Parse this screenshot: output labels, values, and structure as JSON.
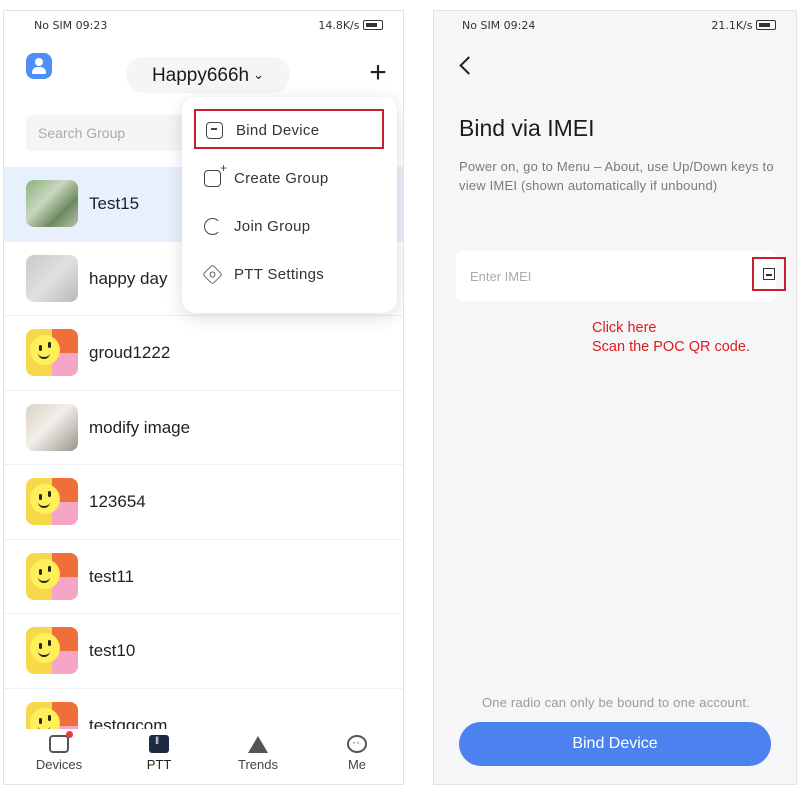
{
  "left_screen": {
    "status_bar": {
      "left": "No SIM 09:23",
      "right": "14.8K/s"
    },
    "header": {
      "account_name": "Happy666h",
      "chevron": "⌄",
      "plus": "+"
    },
    "search": {
      "placeholder": "Search Group"
    },
    "groups": [
      {
        "name": "Test15",
        "avatar": "photo-plant",
        "selected": true
      },
      {
        "name": "happy day",
        "avatar": "photo-wall"
      },
      {
        "name": "groud1222",
        "avatar": "emoji"
      },
      {
        "name": "modify image",
        "avatar": "photo-cup"
      },
      {
        "name": "123654",
        "avatar": "emoji"
      },
      {
        "name": "test11",
        "avatar": "emoji"
      },
      {
        "name": "test10",
        "avatar": "emoji"
      },
      {
        "name": "testqqcom",
        "avatar": "emoji"
      }
    ],
    "menu": {
      "items": [
        {
          "label": "Bind Device",
          "icon": "bind-device-icon",
          "highlighted": true
        },
        {
          "label": "Create Group",
          "icon": "create-group-icon"
        },
        {
          "label": "Join Group",
          "icon": "join-group-icon"
        },
        {
          "label": "PTT Settings",
          "icon": "settings-icon"
        }
      ]
    },
    "bottom_nav": {
      "items": [
        {
          "label": "Devices",
          "icon": "devices-icon",
          "badge": true
        },
        {
          "label": "PTT",
          "icon": "ptt-icon",
          "active": true
        },
        {
          "label": "Trends",
          "icon": "trends-icon"
        },
        {
          "label": "Me",
          "icon": "me-icon"
        }
      ]
    }
  },
  "right_screen": {
    "status_bar": {
      "left": "No SIM 09:24",
      "right": "21.1K/s"
    },
    "title": "Bind via IMEI",
    "instructions": "Power on, go to Menu – About, use Up/Down keys to view IMEI (shown automatically if unbound)",
    "imei_input": {
      "placeholder": "Enter IMEI",
      "value": ""
    },
    "annotation": {
      "line1": "Click here",
      "line2": "Scan the POC QR code."
    },
    "note": "One radio can only be bound to one account.",
    "bind_button": "Bind Device"
  },
  "colors": {
    "accent_blue": "#4b82f0",
    "highlight_red": "#c8202a",
    "annotation_red": "#d81e1e",
    "selected_row": "#e9f0fd"
  }
}
